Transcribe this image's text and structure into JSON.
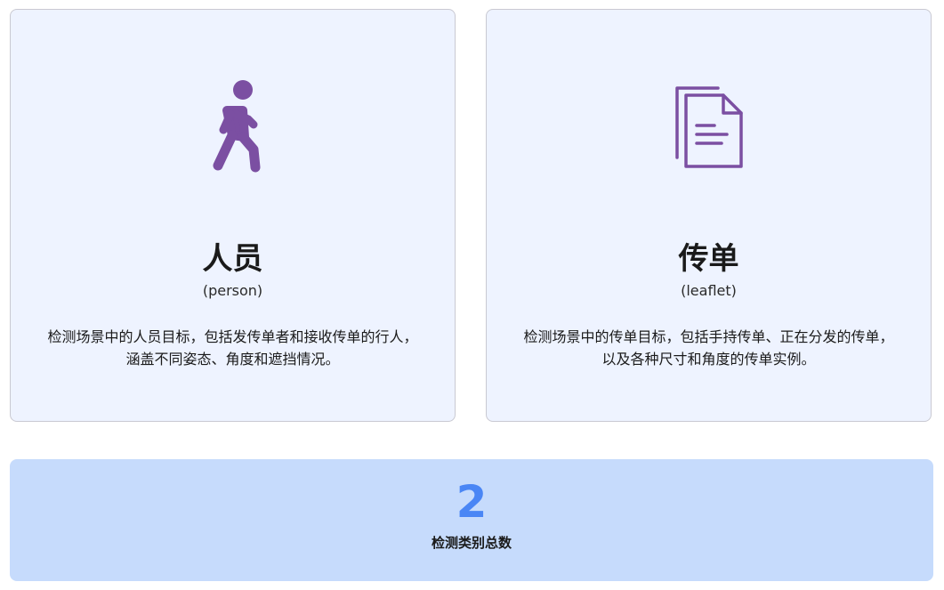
{
  "accent_color": "#7b4fa2",
  "count_color": "#4a86f5",
  "cards": [
    {
      "icon": "walking-person-icon",
      "title": "人员",
      "subtitle": "(person)",
      "description": "检测场景中的人员目标，包括发传单者和接收传单的行人， 涵盖不同姿态、角度和遮挡情况。"
    },
    {
      "icon": "document-icon",
      "title": "传单",
      "subtitle": "(leaflet)",
      "description": "检测场景中的传单目标，包括手持传单、正在分发的传单， 以及各种尺寸和角度的传单实例。"
    }
  ],
  "summary": {
    "count": "2",
    "label": "检测类别总数"
  }
}
